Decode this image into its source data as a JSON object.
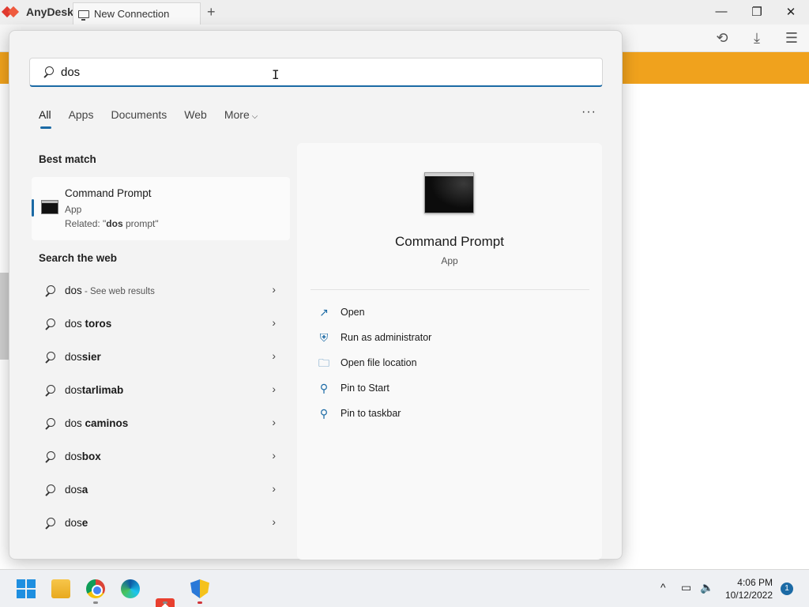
{
  "anydesk": {
    "app_name": "AnyDesk",
    "tab_label": "New Connection",
    "new_tab": "+",
    "window_controls": {
      "minimize": "—",
      "restore": "❐",
      "close": "✕"
    },
    "toolbar_icons": [
      "history-icon",
      "download-icon",
      "menu-icon"
    ],
    "accent_color": "#f0a21d"
  },
  "search": {
    "query": "dos",
    "tabs": [
      {
        "label": "All",
        "active": true
      },
      {
        "label": "Apps"
      },
      {
        "label": "Documents"
      },
      {
        "label": "Web"
      },
      {
        "label": "More"
      }
    ],
    "more_options": "···",
    "best_match_title": "Best match",
    "best_match": {
      "name": "Command Prompt",
      "type": "App",
      "related_prefix": "Related: \"",
      "related_bold": "dos",
      "related_suffix": " prompt\""
    },
    "web_title": "Search the web",
    "web_results": [
      {
        "prefix": "dos",
        "rest": "",
        "sub": " - See web results"
      },
      {
        "prefix": "dos ",
        "rest": "toros",
        "sub": ""
      },
      {
        "prefix": "dos",
        "rest": "sier",
        "sub": ""
      },
      {
        "prefix": "dos",
        "rest": "tarlimab",
        "sub": ""
      },
      {
        "prefix": "dos ",
        "rest": "caminos",
        "sub": ""
      },
      {
        "prefix": "dos",
        "rest": "box",
        "sub": ""
      },
      {
        "prefix": "dos",
        "rest": "a",
        "sub": ""
      },
      {
        "prefix": "dos",
        "rest": "e",
        "sub": ""
      }
    ],
    "preview": {
      "name": "Command Prompt",
      "type": "App",
      "actions": [
        {
          "label": "Open",
          "icon": "open-external-icon"
        },
        {
          "label": "Run as administrator",
          "icon": "admin-shield-icon"
        },
        {
          "label": "Open file location",
          "icon": "folder-icon"
        },
        {
          "label": "Pin to Start",
          "icon": "pin-icon"
        },
        {
          "label": "Pin to taskbar",
          "icon": "pin-icon"
        }
      ]
    },
    "accent_color": "#1b6aa5"
  },
  "taskbar": {
    "apps": [
      "start-icon",
      "file-explorer-icon",
      "chrome-icon",
      "edge-icon",
      "anydesk-icon",
      "security-shield-icon"
    ],
    "time": "4:06 PM",
    "date": "10/12/2022",
    "notifications": "1"
  }
}
